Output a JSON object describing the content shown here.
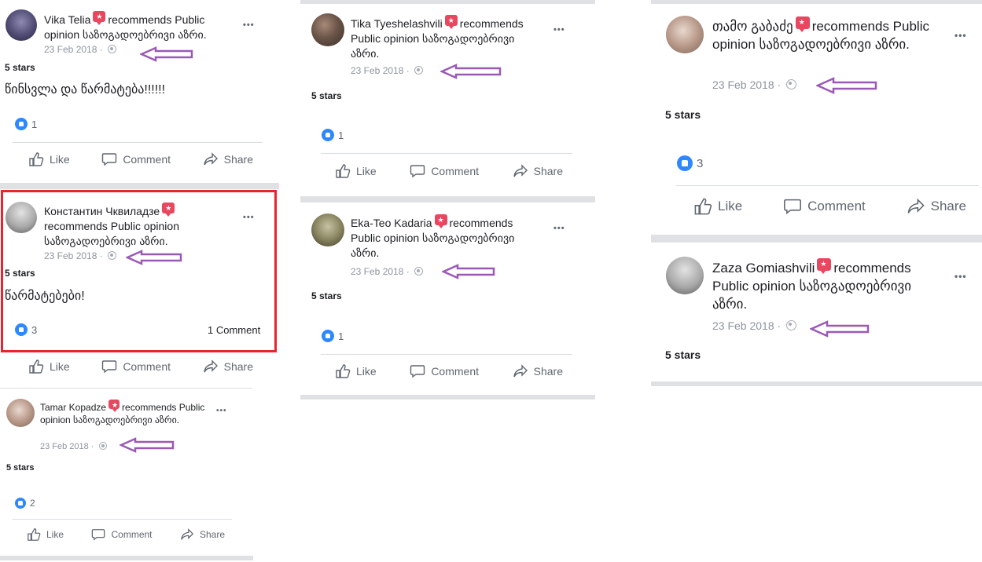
{
  "posts": [
    {
      "name": "Vika Telia",
      "action": "recommends Public opinion საზოგადოებრივი აზრი.",
      "date": "23 Feb 2018",
      "stars": "5 stars",
      "review": "წინსვლა და წარმატება!!!!!!",
      "likes": "1",
      "comments": ""
    },
    {
      "name": "Константин Чквиладзе",
      "action": "recommends Public opinion საზოგადოებრივი აზრი.",
      "date": "23 Feb 2018",
      "stars": "5 stars",
      "review": "წარმატებები!",
      "likes": "3",
      "comments": "1 Comment"
    },
    {
      "name": "Tamar Kopadze",
      "action": "recommends Public opinion საზოგადოებრივი აზრი.",
      "date": "23 Feb 2018",
      "stars": "5 stars",
      "review": "",
      "likes": "2",
      "comments": ""
    },
    {
      "name": "Tika Tyeshelashvili",
      "action": "recommends Public opinion საზოგადოებრივი აზრი.",
      "date": "23 Feb 2018",
      "stars": "5 stars",
      "review": "",
      "likes": "1",
      "comments": ""
    },
    {
      "name": "Eka-Teo Kadaria",
      "action": "recommends Public opinion საზოგადოებრივი აზრი.",
      "date": "23 Feb 2018",
      "stars": "5 stars",
      "review": "",
      "likes": "1",
      "comments": ""
    },
    {
      "name": "თამო გაბაძე",
      "action": "recommends Public opinion საზოგადოებრივი აზრი.",
      "date": "23 Feb 2018",
      "stars": "5 stars",
      "review": "",
      "likes": "3",
      "comments": ""
    },
    {
      "name": "Zaza Gomiashvili",
      "action": "recommends Public opinion საზოგადოებრივი აზრი.",
      "date": "23 Feb 2018",
      "stars": "5 stars",
      "review": "",
      "likes": "",
      "comments": ""
    }
  ],
  "actions": {
    "like": "Like",
    "comment": "Comment",
    "share": "Share"
  },
  "more_glyph": "•••",
  "colors": {
    "like_blue": "#2d88ff",
    "badge_red": "#e8485f",
    "arrow_purple": "#9b59b6",
    "highlight_red": "#e8242e"
  },
  "icons": {
    "recommend": "recommend-badge-icon",
    "audience": "globe-icon",
    "annotation": "left-arrow-icon",
    "like": "thumbs-up-icon",
    "comment": "speech-bubble-icon",
    "share": "share-arrow-icon",
    "reaction": "like-reaction-icon",
    "more": "more-options-icon"
  }
}
